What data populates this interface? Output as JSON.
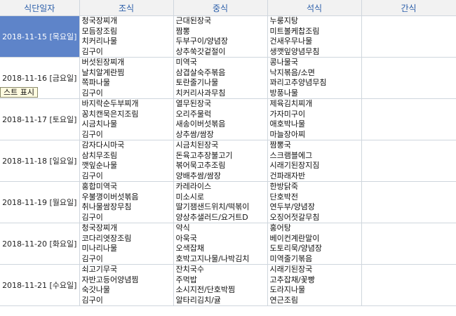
{
  "headers": [
    "식단일자",
    "조식",
    "중식",
    "석식",
    "간식"
  ],
  "tooltip": "스트 표시",
  "rows": [
    {
      "date": "2018-11-15 [목요일]",
      "breakfast": [
        "청국장찌개",
        "모듬장조림",
        "치커리나물",
        "김구이"
      ],
      "lunch": [
        "근대된장국",
        "짬뽕",
        "두부구이/양념장",
        "상추쑥갓겉절이"
      ],
      "dinner": [
        "누룽지탕",
        "미트볼케찹조림",
        "건새우무나물",
        "생깻잎양념무침"
      ],
      "snack": []
    },
    {
      "date": "2018-11-16 [금요일]",
      "breakfast": [
        "버섯된장찌개",
        "날치알계란찜",
        "쪽파나물",
        "김구이"
      ],
      "lunch": [
        "미역국",
        "삼겹살숙주볶음",
        "토란줄기나물",
        "치커리사과무침"
      ],
      "dinner": [
        "콩나물국",
        "낙지볶음/소면",
        "꽈리고추양념무침",
        "방풍나물"
      ],
      "snack": []
    },
    {
      "date": "2018-11-17 [토요일]",
      "breakfast": [
        "바지락순두부찌개",
        "꽁치캔묵은지조림",
        "시금치나물",
        "김구이"
      ],
      "lunch": [
        "열무된장국",
        "오리주물럭",
        "새송이버섯볶음",
        "상추쌈/쌈장"
      ],
      "dinner": [
        "제육김치찌개",
        "가자미구이",
        "애호박나물",
        "마늘장아찌"
      ],
      "snack": []
    },
    {
      "date": "2018-11-18 [일요일]",
      "breakfast": [
        "감자다시마국",
        "삼치무조림",
        "깻잎순나물",
        "김구이"
      ],
      "lunch": [
        "시금치된장국",
        "돈육고추장불고기",
        "볶어묵고추조림",
        "양배추쌈/쌈장"
      ],
      "dinner": [
        "짬뽕국",
        "스크램블에그",
        "시래기된장지짐",
        "건파래자반"
      ],
      "snack": []
    },
    {
      "date": "2018-11-19 [월요일]",
      "breakfast": [
        "홍합미역국",
        "우불꼉이버섯볶음",
        "취나물쌈장무침",
        "김구이"
      ],
      "lunch": [
        "카레라이스",
        "미소시로",
        "딸기잼샌드위치/떡볶이",
        "양상추샐러드/요거트D"
      ],
      "dinner": [
        "한방닭죽",
        "단호박전",
        "연두부/양념장",
        "오징어젓갈무침"
      ],
      "snack": []
    },
    {
      "date": "2018-11-20 [화요일]",
      "breakfast": [
        "청국장찌개",
        "코다리엿장조림",
        "미나리나물",
        "김구이"
      ],
      "lunch": [
        "약식",
        "아욱국",
        "오색잡채",
        "호박고지나물/나박김치"
      ],
      "dinner": [
        "홍어탕",
        "베이컨계란말이",
        "도토리묵/양념장",
        "미역줄기볶음"
      ],
      "snack": []
    },
    {
      "date": "2018-11-21 [수요일]",
      "breakfast": [
        "쇠고기무국",
        "자반고등어양념찜",
        "숙갓나물",
        "김구이"
      ],
      "lunch": [
        "잔치국수",
        "주먹밥",
        "소시지전/단호박찜",
        "알타리김치/귤"
      ],
      "dinner": [
        "시래기된장국",
        "고추잡채/꽃빵",
        "도라지나물",
        "연근조림"
      ],
      "snack": []
    }
  ]
}
